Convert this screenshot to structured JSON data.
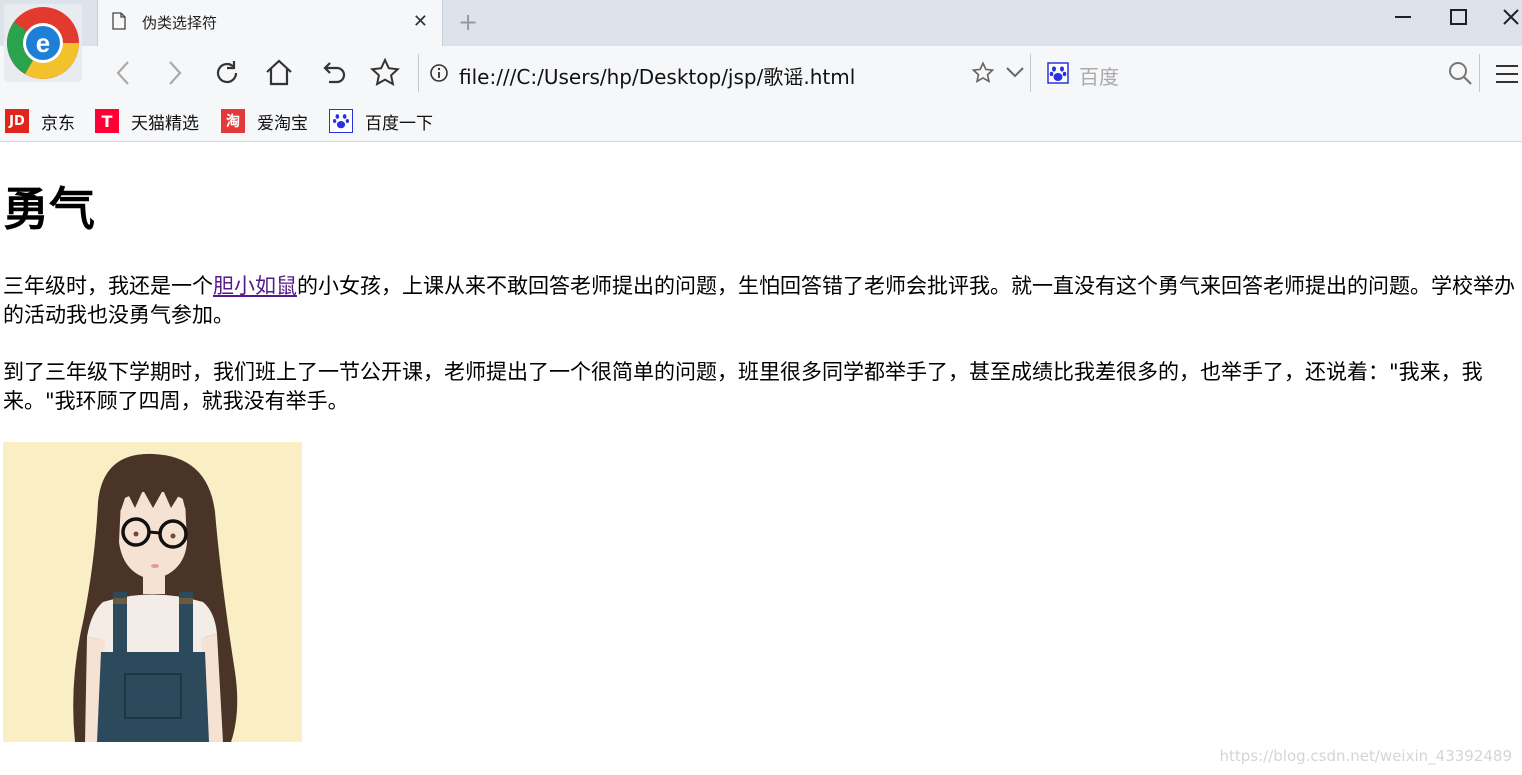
{
  "browser": {
    "tab": {
      "title": "伪类选择符"
    },
    "address": "file:///C:/Users/hp/Desktop/jsp/歌谣.html",
    "search": {
      "placeholder": "百度"
    },
    "bookmarks": [
      {
        "label": "京东",
        "icon": "jd-icon",
        "icon_text": "JD",
        "color": "#e1251b"
      },
      {
        "label": "天猫精选",
        "icon": "tmall-icon",
        "icon_text": "T",
        "color": "#ff0036"
      },
      {
        "label": "爱淘宝",
        "icon": "taobao-icon",
        "icon_text": "淘",
        "color": "#e4393c"
      },
      {
        "label": "百度一下",
        "icon": "baidu-paw-icon",
        "icon_text": "",
        "color": "#2932e1"
      }
    ]
  },
  "page": {
    "heading": "勇气",
    "p1_before": "三年级时，我还是一个",
    "p1_link": "胆小如鼠",
    "p1_after": "的小女孩，上课从来不敢回答老师提出的问题，生怕回答错了老师会批评我。就一直没有这个勇气来回答老师提出的问题。学校举办的活动我也没勇气参加。",
    "p2": "到了三年级下学期时，我们班上了一节公开课，老师提出了一个很简单的问题，班里很多同学都举手了，甚至成绩比我差很多的，也举手了，还说着：\"我来，我来。\"我环顾了四周，就我没有举手。",
    "image": "girl-illustration"
  },
  "watermark": "https://blog.csdn.net/weixin_43392489"
}
